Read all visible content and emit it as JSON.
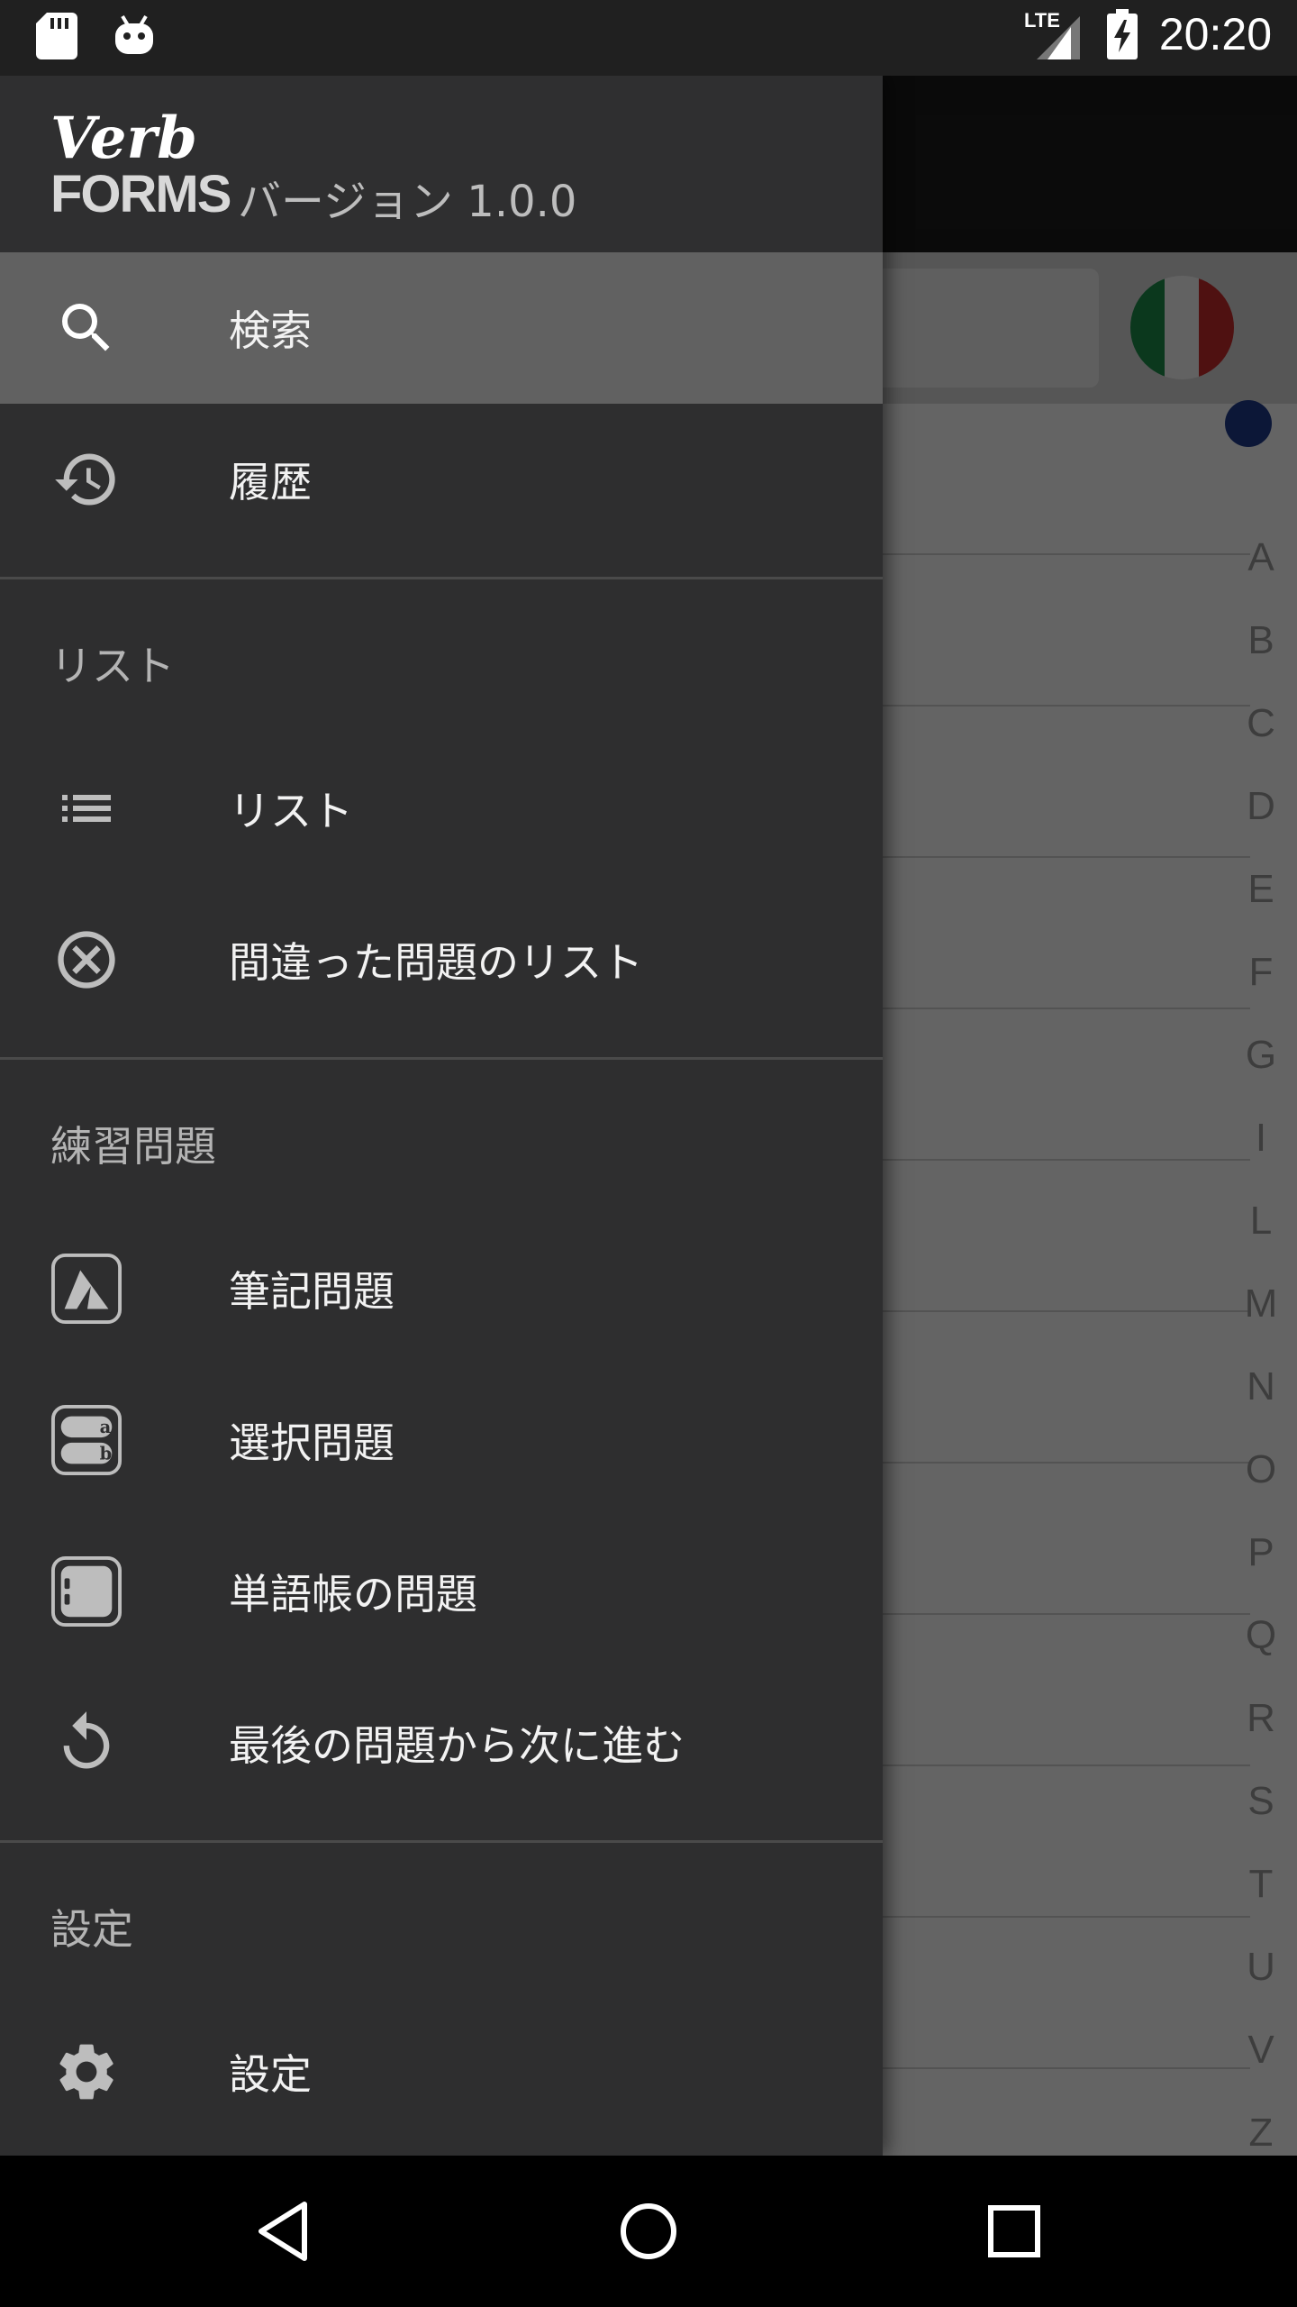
{
  "status_bar": {
    "time": "20:20",
    "network": "LTE"
  },
  "drawer": {
    "logo": {
      "top": "Verb",
      "bottom": "FORMS"
    },
    "version": "バージョン 1.0.0",
    "items_top": [
      {
        "label": "検索",
        "icon": "search-icon",
        "active": true
      },
      {
        "label": "履歴",
        "icon": "history-icon",
        "active": false
      }
    ],
    "section_lists": {
      "header": "リスト",
      "items": [
        {
          "label": "リスト",
          "icon": "list-icon"
        },
        {
          "label": "間違った問題のリスト",
          "icon": "cancel-circle-icon"
        }
      ]
    },
    "section_exercises": {
      "header": "練習問題",
      "items": [
        {
          "label": "筆記問題",
          "icon": "written-exercise-icon"
        },
        {
          "label": "選択問題",
          "icon": "multiple-choice-icon"
        },
        {
          "label": "単語帳の問題",
          "icon": "flashcard-icon"
        },
        {
          "label": "最後の問題から次に進む",
          "icon": "resume-icon"
        }
      ]
    },
    "section_settings": {
      "header": "設定",
      "items": [
        {
          "label": "設定",
          "icon": "gear-icon"
        }
      ]
    }
  },
  "background_app": {
    "alphabet_index": [
      "A",
      "B",
      "C",
      "D",
      "E",
      "F",
      "G",
      "I",
      "L",
      "M",
      "N",
      "O",
      "P",
      "Q",
      "R",
      "S",
      "T",
      "U",
      "V",
      "Z"
    ]
  },
  "navigation_bar": {
    "buttons": [
      "back-icon",
      "home-icon",
      "recents-icon"
    ]
  },
  "colors": {
    "drawer_bg": "#2e2e2f",
    "active_item_bg": "#616161",
    "section_header_text": "#b4b4b4"
  }
}
